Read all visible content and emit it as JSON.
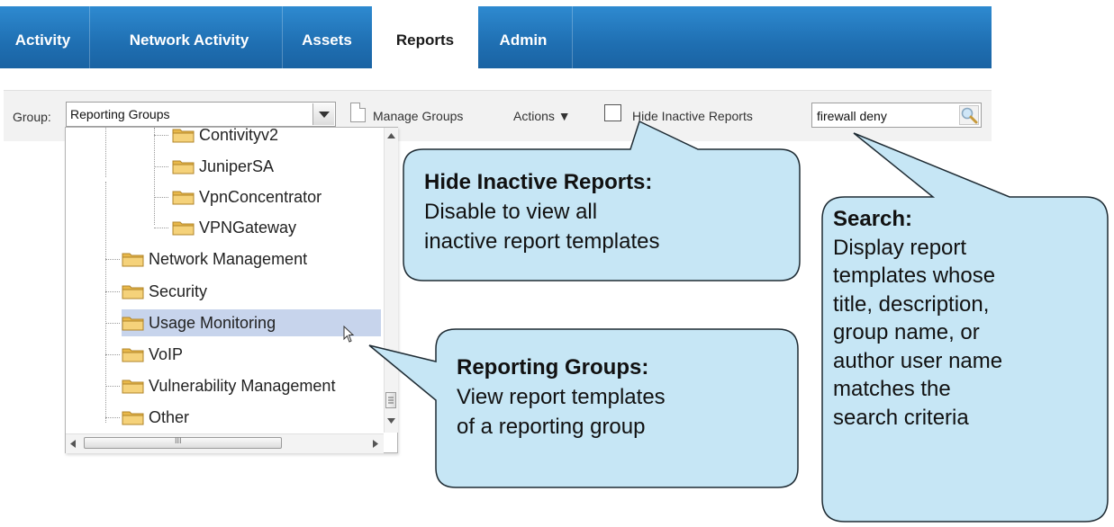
{
  "nav": {
    "tabs": [
      {
        "label": "Activity"
      },
      {
        "label": "Network Activity"
      },
      {
        "label": "Assets"
      },
      {
        "label": "Reports",
        "active": true
      },
      {
        "label": "Admin"
      }
    ]
  },
  "toolbar": {
    "group_label": "Group:",
    "group_value": "Reporting Groups",
    "manage_groups": "Manage Groups",
    "actions": "Actions ▼",
    "hide_inactive": "Hide Inactive Reports",
    "search_value": "firewall deny"
  },
  "tree": {
    "items": [
      {
        "label": "Contivityv2"
      },
      {
        "label": "JuniperSA"
      },
      {
        "label": "VpnConcentrator"
      },
      {
        "label": "VPNGateway"
      },
      {
        "label": "Network Management"
      },
      {
        "label": "Security"
      },
      {
        "label": "Usage Monitoring",
        "selected": true
      },
      {
        "label": "VoIP"
      },
      {
        "label": "Vulnerability Management"
      },
      {
        "label": "Other"
      }
    ],
    "hscroll_grip": "III"
  },
  "callouts": {
    "hide_inactive": {
      "title": "Hide Inactive Reports:",
      "lines": [
        "Disable to view all",
        "inactive report templates"
      ]
    },
    "reporting_groups": {
      "title": "Reporting Groups:",
      "lines": [
        "View report templates",
        "of a reporting group"
      ]
    },
    "search": {
      "title": "Search:",
      "lines": [
        "Display report",
        "templates whose",
        "title, description,",
        "group name, or",
        "author user name",
        "matches the",
        "search criteria"
      ]
    }
  },
  "colors": {
    "nav_blue": "#1f6fb2",
    "callout_fill": "#c6e6f5",
    "selected_row": "#c7d4ec"
  }
}
